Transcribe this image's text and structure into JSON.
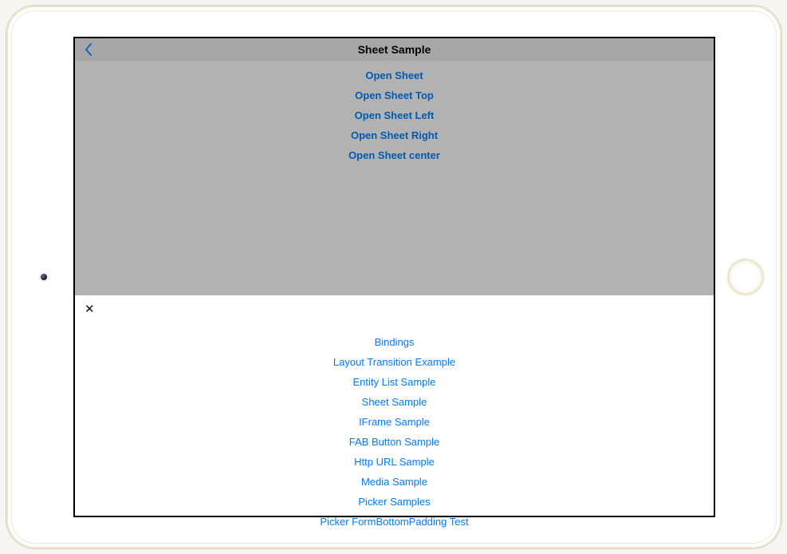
{
  "navbar": {
    "title": "Sheet Sample"
  },
  "top_actions": [
    "Open Sheet",
    "Open Sheet Top",
    "Open Sheet Left",
    "Open Sheet Right",
    "Open Sheet center"
  ],
  "sheet_links": [
    "Bindings",
    "Layout Transition Example",
    "Entity List Sample",
    "Sheet Sample",
    "IFrame Sample",
    "FAB Button Sample",
    "Http URL Sample",
    "Media Sample",
    "Picker Samples",
    "Picker FormBottomPadding Test"
  ]
}
